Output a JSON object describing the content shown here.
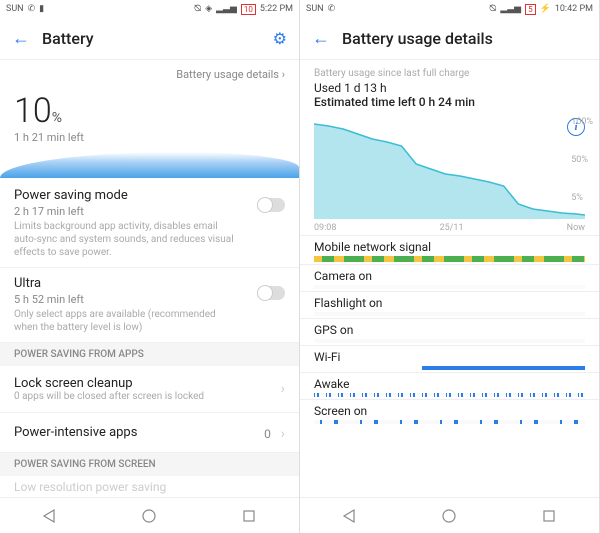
{
  "left": {
    "status": {
      "carrier": "SUN",
      "time": "5:22 PM",
      "battery": "10"
    },
    "header": {
      "title": "Battery"
    },
    "details_link": "Battery usage details",
    "percent": "10",
    "percent_symbol": "%",
    "time_left": "1 h 21 min left",
    "power_saving": {
      "title": "Power saving mode",
      "sub": "2 h 17 min left",
      "desc": "Limits background app activity, disables email auto-sync and system sounds, and reduces visual effects to save power."
    },
    "ultra": {
      "title": "Ultra",
      "sub": "5 h 52 min left",
      "desc": "Only select apps are available (recommended when the battery level is low)"
    },
    "section_apps": "POWER SAVING FROM APPS",
    "lock_cleanup": {
      "title": "Lock screen cleanup",
      "sub": "0 apps will be closed after screen is locked"
    },
    "intensive": {
      "title": "Power-intensive apps",
      "value": "0"
    },
    "section_screen": "POWER SAVING FROM SCREEN",
    "truncated_row": "Low resolution power saving"
  },
  "right": {
    "status": {
      "carrier": "SUN",
      "time": "10:42 PM",
      "battery": "5"
    },
    "header": {
      "title": "Battery usage details"
    },
    "usage": {
      "label": "Battery usage since last full charge",
      "used": "Used 1 d 13 h",
      "est": "Estimated time left 0 h 24 min"
    },
    "chart_data": {
      "type": "area",
      "x_ticks": [
        "09:08",
        "25/11",
        "Now"
      ],
      "y_ticks": [
        "100%",
        "50%",
        "5%"
      ],
      "series": [
        {
          "name": "battery",
          "values": [
            100,
            98,
            95,
            90,
            85,
            82,
            78,
            60,
            55,
            50,
            48,
            45,
            42,
            38,
            20,
            15,
            10,
            8,
            6,
            5
          ]
        }
      ],
      "ylim": [
        0,
        100
      ]
    },
    "timelines": {
      "mobile": "Mobile network signal",
      "camera": "Camera on",
      "flashlight": "Flashlight on",
      "gps": "GPS on",
      "wifi": "Wi-Fi",
      "awake": "Awake",
      "screen": "Screen on"
    }
  }
}
